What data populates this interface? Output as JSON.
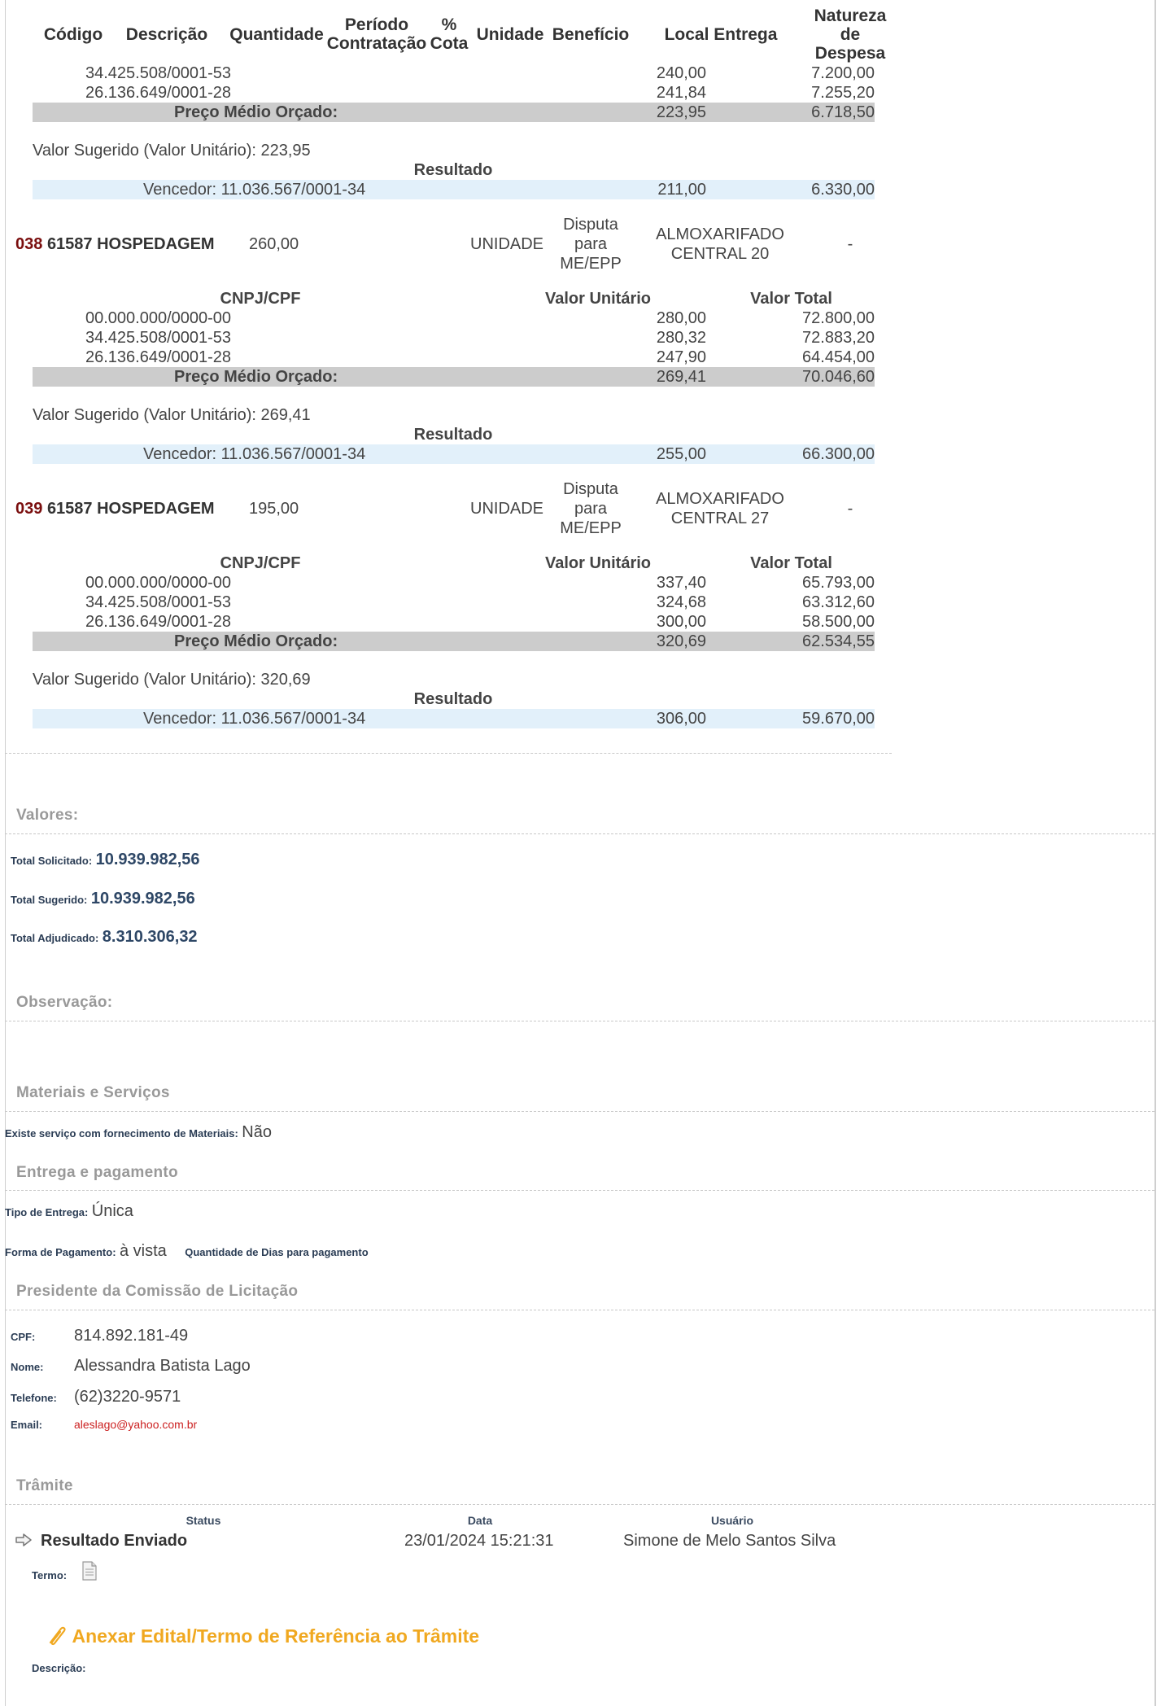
{
  "header": {
    "codigo": "Código",
    "descricao": "Descrição",
    "quantidade": "Quantidade",
    "periodo_1": "Período",
    "periodo_2": "Contratação",
    "cota_1": "%",
    "cota_2": "Cota",
    "unidade": "Unidade",
    "beneficio": "Benefício",
    "local": "Local Entrega",
    "natureza_1": "Natureza",
    "natureza_2": "de",
    "natureza_3": "Despesa"
  },
  "item037": {
    "quotes": [
      {
        "cnpj": "34.425.508/0001-53",
        "unit": "240,00",
        "total": "7.200,00"
      },
      {
        "cnpj": "26.136.649/0001-28",
        "unit": "241,84",
        "total": "7.255,20"
      }
    ],
    "avg_label": "Preço Médio Orçado:",
    "avg_unit": "223,95",
    "avg_total": "6.718,50",
    "suggested": "Valor Sugerido (Valor Unitário): 223,95",
    "result_label": "Resultado",
    "winner": "Vencedor: 11.036.567/0001-34",
    "winner_unit": "211,00",
    "winner_total": "6.330,00"
  },
  "item038": {
    "num": "038",
    "desc": "61587 HOSPEDAGEM",
    "qty": "260,00",
    "unit_type": "UNIDADE",
    "benefit_1": "Disputa",
    "benefit_2": "para",
    "benefit_3": "ME/EPP",
    "local_1": "ALMOXARIFADO",
    "local_2": "CENTRAL 20",
    "nature": "-",
    "col_cnpj": "CNPJ/CPF",
    "col_unit": "Valor Unitário",
    "col_total": "Valor Total",
    "quotes": [
      {
        "cnpj": "00.000.000/0000-00",
        "unit": "280,00",
        "total": "72.800,00"
      },
      {
        "cnpj": "34.425.508/0001-53",
        "unit": "280,32",
        "total": "72.883,20"
      },
      {
        "cnpj": "26.136.649/0001-28",
        "unit": "247,90",
        "total": "64.454,00"
      }
    ],
    "avg_label": "Preço Médio Orçado:",
    "avg_unit": "269,41",
    "avg_total": "70.046,60",
    "suggested": "Valor Sugerido (Valor Unitário): 269,41",
    "result_label": "Resultado",
    "winner": "Vencedor: 11.036.567/0001-34",
    "winner_unit": "255,00",
    "winner_total": "66.300,00"
  },
  "item039": {
    "num": "039",
    "desc": "61587 HOSPEDAGEM",
    "qty": "195,00",
    "unit_type": "UNIDADE",
    "benefit_1": "Disputa",
    "benefit_2": "para",
    "benefit_3": "ME/EPP",
    "local_1": "ALMOXARIFADO",
    "local_2": "CENTRAL 27",
    "nature": "-",
    "col_cnpj": "CNPJ/CPF",
    "col_unit": "Valor Unitário",
    "col_total": "Valor Total",
    "quotes": [
      {
        "cnpj": "00.000.000/0000-00",
        "unit": "337,40",
        "total": "65.793,00"
      },
      {
        "cnpj": "34.425.508/0001-53",
        "unit": "324,68",
        "total": "63.312,60"
      },
      {
        "cnpj": "26.136.649/0001-28",
        "unit": "300,00",
        "total": "58.500,00"
      }
    ],
    "avg_label": "Preço Médio Orçado:",
    "avg_unit": "320,69",
    "avg_total": "62.534,55",
    "suggested": "Valor Sugerido (Valor Unitário): 320,69",
    "result_label": "Resultado",
    "winner": "Vencedor: 11.036.567/0001-34",
    "winner_unit": "306,00",
    "winner_total": "59.670,00"
  },
  "valores": {
    "title": "Valores:",
    "solicitado_label": "Total Solicitado:",
    "solicitado": "10.939.982,56",
    "sugerido_label": "Total Sugerido:",
    "sugerido": "10.939.982,56",
    "adjudicado_label": "Total Adjudicado:",
    "adjudicado": "8.310.306,32"
  },
  "observacao": {
    "title": "Observação:"
  },
  "materiais": {
    "title": "Materiais e Serviços",
    "label": "Existe serviço com fornecimento de Materiais:",
    "value": "Não"
  },
  "entrega": {
    "title": "Entrega e pagamento",
    "tipo_label": "Tipo de Entrega:",
    "tipo": "Única",
    "forma_label": "Forma de Pagamento:",
    "forma": "à vista",
    "dias_label": "Quantidade de Dias para pagamento"
  },
  "presidente": {
    "title": "Presidente da Comissão de Licitação",
    "cpf_label": "CPF:",
    "cpf": "814.892.181-49",
    "nome_label": "Nome:",
    "nome": "Alessandra Batista Lago",
    "tel_label": "Telefone:",
    "tel": "(62)3220-9571",
    "email_label": "Email:",
    "email": "aleslago@yahoo.com.br"
  },
  "tramite": {
    "title": "Trâmite",
    "col_status": "Status",
    "col_data": "Data",
    "col_usuario": "Usuário",
    "status": "Resultado Enviado",
    "data": "23/01/2024 15:21:31",
    "usuario": "Simone de Melo Santos Silva",
    "termo_label": "Termo:",
    "attach_label": "Anexar Edital/Termo de Referência ao Trâmite",
    "descricao_label": "Descrição:"
  }
}
